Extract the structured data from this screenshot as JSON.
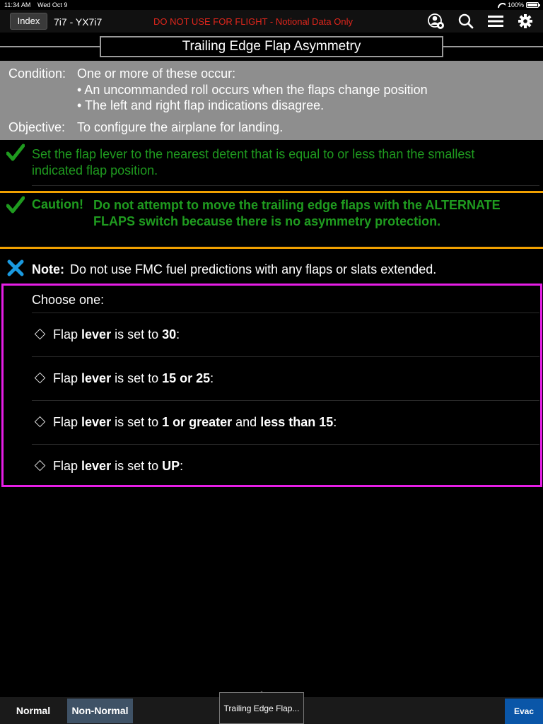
{
  "status_bar": {
    "time": "11:34 AM",
    "date": "Wed Oct 9",
    "battery": "100%",
    "battery_level": 1.0
  },
  "nav": {
    "index_label": "Index",
    "aircraft_id": "7i7 - YX7i7",
    "warning": "DO NOT USE FOR FLIGHT - Notional Data Only",
    "icons": [
      "user-settings-icon",
      "search-icon",
      "menu-icon",
      "gear-icon"
    ]
  },
  "title": "Trailing Edge Flap Asymmetry",
  "condition": {
    "label": "Condition:",
    "text": "One or more of these occur:",
    "bullets": [
      "• An uncommanded roll occurs when the flaps change position",
      "• The left and right flap indications disagree."
    ],
    "objective_label": "Objective:",
    "objective_text": "To configure the airplane for landing."
  },
  "step1": {
    "icon": "check-icon",
    "text": "Set the flap lever to the nearest detent that is equal to or less than the smallest indicated flap position."
  },
  "caution": {
    "icon": "check-icon",
    "label": "Caution!",
    "text": "Do not attempt to move the trailing edge flaps with the ALTERNATE FLAPS switch because there is no asymmetry protection."
  },
  "note": {
    "icon": "x-icon",
    "label": "Note:",
    "text": "Do not use FMC fuel predictions with any flaps or slats extended."
  },
  "choose": {
    "title": "Choose one:",
    "options": [
      {
        "a": "Flap ",
        "b": "lever",
        "c": " is set to ",
        "d": "30",
        "e": ":",
        "f": "",
        "g": ""
      },
      {
        "a": "Flap ",
        "b": "lever",
        "c": " is set to ",
        "d": "15 or 25",
        "e": ":",
        "f": "",
        "g": ""
      },
      {
        "a": "Flap ",
        "b": "lever",
        "c": " is set to ",
        "d": "1 or greater",
        "e": " and ",
        "f": "less than 15",
        "g": ":"
      },
      {
        "a": "Flap ",
        "b": "lever",
        "c": " is set to ",
        "d": "UP",
        "e": ":",
        "f": "",
        "g": ""
      }
    ]
  },
  "bottom_bar": {
    "normal": "Normal",
    "non_normal": "Non-Normal",
    "current": "Trailing Edge Flap...",
    "evac": "Evac"
  },
  "colors": {
    "warning_red": "#e0261c",
    "check_green": "#1f9b1f",
    "caution_orange": "#f0a000",
    "choose_magenta": "#e61ee6",
    "note_x_blue": "#1a9ae0",
    "evac_blue": "#0a56a8"
  }
}
